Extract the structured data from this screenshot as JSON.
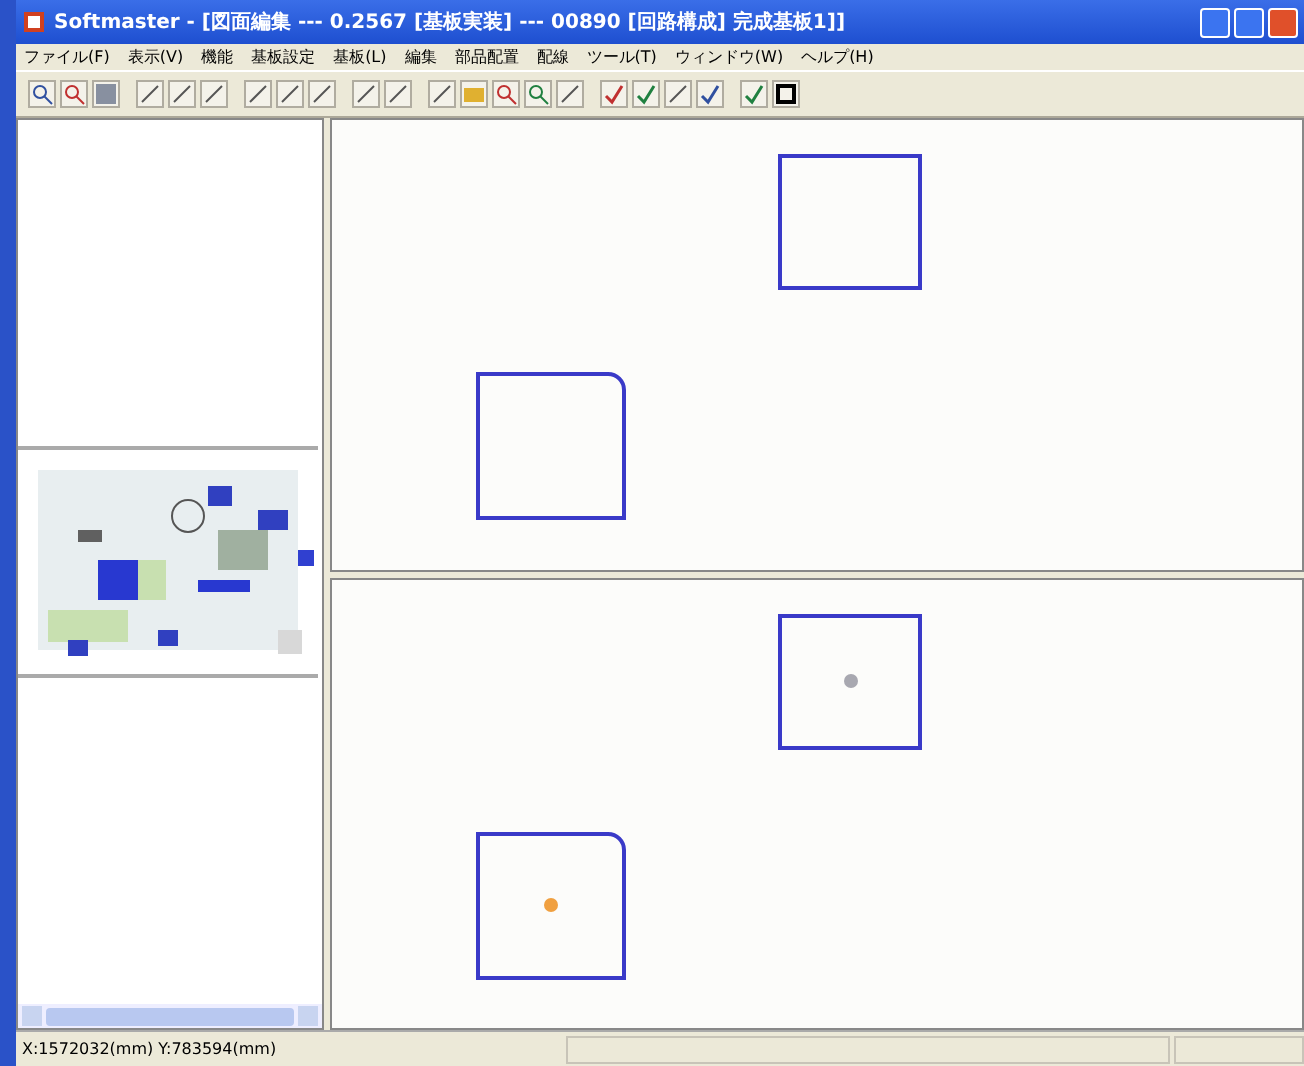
{
  "window": {
    "title": "Softmaster - [図面編集 --- 0.2567 [基板実装] --- 00890 [回路構成] 完成基板1]]"
  },
  "menu": [
    "ファイル(F)",
    "表示(V)",
    "機能",
    "基板設定",
    "基板(L)",
    "編集",
    "部品配置",
    "配線",
    "ツール(T)",
    "ウィンドウ(W)",
    "ヘルプ(H)"
  ],
  "views": [
    {
      "pads": [
        {
          "kind": "plain"
        },
        {
          "kind": "plain"
        }
      ]
    },
    {
      "pads": [
        {
          "kind": "marked",
          "color": "#a8a8b0"
        },
        {
          "kind": "marked",
          "color": "#f0a040"
        }
      ]
    }
  ],
  "status_bar": {
    "text": "X:1572032(mm) Y:783594(mm)"
  }
}
